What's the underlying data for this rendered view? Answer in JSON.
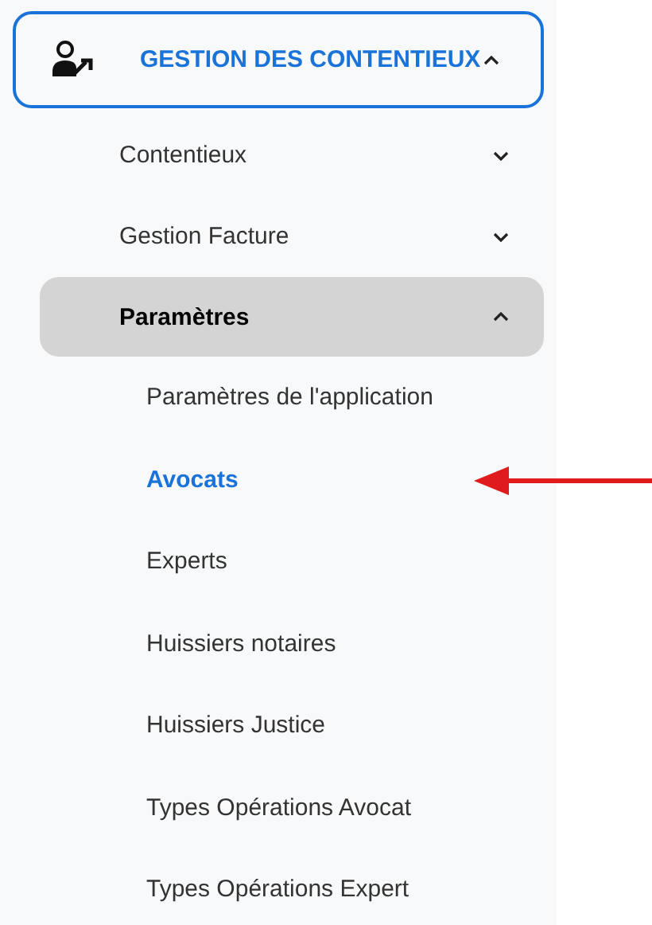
{
  "menu": {
    "title": "GESTION DES CONTENTIEUX",
    "expanded": true,
    "selected": true,
    "children": [
      {
        "label": "Contentieux",
        "expanded": false,
        "selected": false
      },
      {
        "label": "Gestion Facture",
        "expanded": false,
        "selected": false
      },
      {
        "label": "Paramètres",
        "expanded": true,
        "selected": true,
        "children": [
          {
            "label": "Paramètres de l'application",
            "selected": false
          },
          {
            "label": "Avocats",
            "selected": true
          },
          {
            "label": "Experts",
            "selected": false
          },
          {
            "label": "Huissiers notaires",
            "selected": false
          },
          {
            "label": "Huissiers Justice",
            "selected": false
          },
          {
            "label": "Types Opérations Avocat",
            "selected": false
          },
          {
            "label": "Types Opérations Expert",
            "selected": false
          }
        ]
      }
    ]
  }
}
